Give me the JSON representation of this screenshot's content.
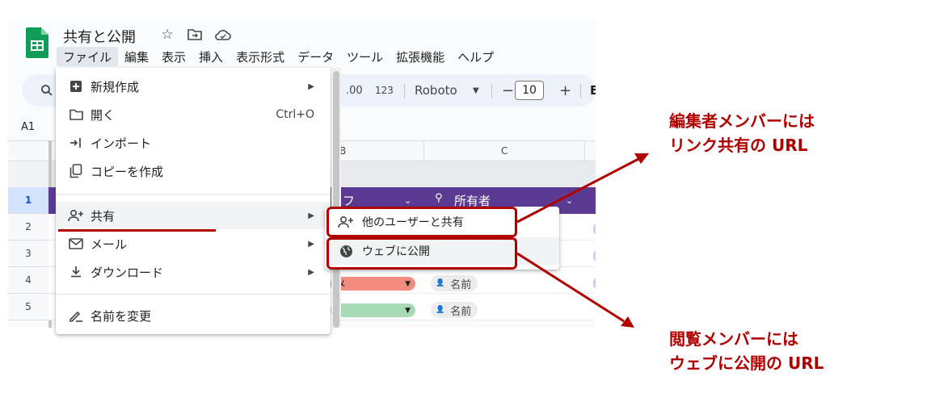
{
  "document": {
    "title": "共有と公開"
  },
  "menubar": {
    "items": [
      "ファイル",
      "編集",
      "表示",
      "挿入",
      "表示形式",
      "データ",
      "ツール",
      "拡張機能",
      "ヘルプ"
    ]
  },
  "toolbar": {
    "format_00": ".00",
    "format_123": "123",
    "font_name": "Roboto",
    "font_size": "10",
    "minus": "−",
    "plus": "+",
    "bold": "B"
  },
  "namebox": "A1",
  "grid": {
    "col_b": "B",
    "col_c": "C",
    "row_numbers": [
      "1",
      "2",
      "3",
      "4",
      "5"
    ],
    "row1_partial": "フ",
    "owner_header": "所有者",
    "status_chip_red": "メ",
    "name_chip": "名前"
  },
  "file_menu": {
    "new": "新規作成",
    "open": "開く",
    "open_shortcut": "Ctrl+O",
    "import": "インポート",
    "copy": "コピーを作成",
    "share": "共有",
    "mail": "メール",
    "download": "ダウンロード",
    "rename": "名前を変更"
  },
  "share_submenu": {
    "share_with_others": "他のユーザーと共有",
    "publish_to_web": "ウェブに公開"
  },
  "annotations": {
    "editor_line1": "編集者メンバーには",
    "editor_line2": "リンク共有の URL",
    "viewer_line1": "閲覧メンバーには",
    "viewer_line2": "ウェブに公開の URL"
  },
  "colors": {
    "accent_red": "#b00000",
    "header_purple": "#5b3a92",
    "sheets_green": "#0f9d58",
    "chip_red": "#f28b82",
    "chip_green": "#a8dab5"
  }
}
